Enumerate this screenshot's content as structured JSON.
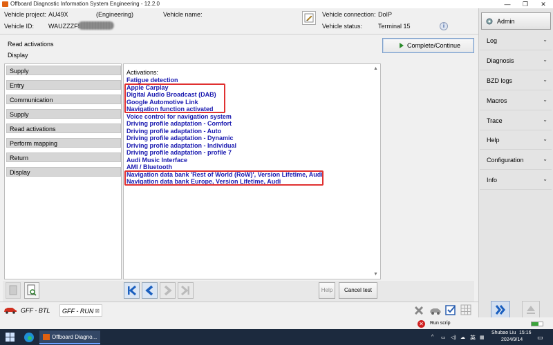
{
  "window": {
    "title": "Offboard Diagnostic Information System Engineering - 12.2.0"
  },
  "header": {
    "vehicle_project_label": "Vehicle project:",
    "vehicle_project_value": "AU49X",
    "mode": "(Engineering)",
    "vehicle_name_label": "Vehicle name:",
    "vehicle_connection_label": "Vehicle connection:",
    "vehicle_connection_value": "DoIP",
    "vehicle_id_label": "Vehicle ID:",
    "vehicle_id_value": "WAUZZZF5X",
    "vehicle_status_label": "Vehicle status:",
    "vehicle_status_value": "Terminal 15"
  },
  "breadcrumb": {
    "line1": "Read activations",
    "line2": "Display"
  },
  "complete_button": "Complete/Continue",
  "steps": [
    "Supply",
    "Entry",
    "Communication",
    "Supply",
    "Read activations",
    "Perform mapping",
    "Return",
    "Display"
  ],
  "activations": {
    "heading": "Activations:",
    "items": [
      "Fatigue detection",
      "Apple Carplay",
      "Digital Audio Broadcast (DAB)",
      "Google Automotive Link",
      "Navigation function activated",
      "Voice control for navigation system",
      "Driving profile adaptation - Comfort",
      "Driving profile adaptation - Auto",
      "Driving profile adaptation - Dynamic",
      "Driving profile adaptation - Individual",
      "Driving profile adaptation - profile 7",
      "Audi Music Interface",
      "AMI / Bluetooth",
      "Navigation data bank 'Rest of World (RoW)', Version Lifetime, Audi",
      "Navigation data bank Europe, Version Lifetime, Audi"
    ]
  },
  "right_menu": {
    "admin": "Admin",
    "items": [
      "Log",
      "Diagnosis",
      "BZD logs",
      "Macros",
      "Trace",
      "Help",
      "Configuration",
      "Info"
    ]
  },
  "bottom_buttons": {
    "help": "Help",
    "cancel": "Cancel test"
  },
  "tabs": [
    "GFF - BTL",
    "GFF - RUN"
  ],
  "status": {
    "run_script": "Run scrip"
  },
  "taskbar": {
    "app": "Offboard Diagno...",
    "user": "Shubao Liu",
    "time": "15:16",
    "date": "2024/9/14",
    "ime": "英"
  },
  "colors": {
    "activation_text": "#1919b0",
    "highlight_box": "#e03030"
  }
}
